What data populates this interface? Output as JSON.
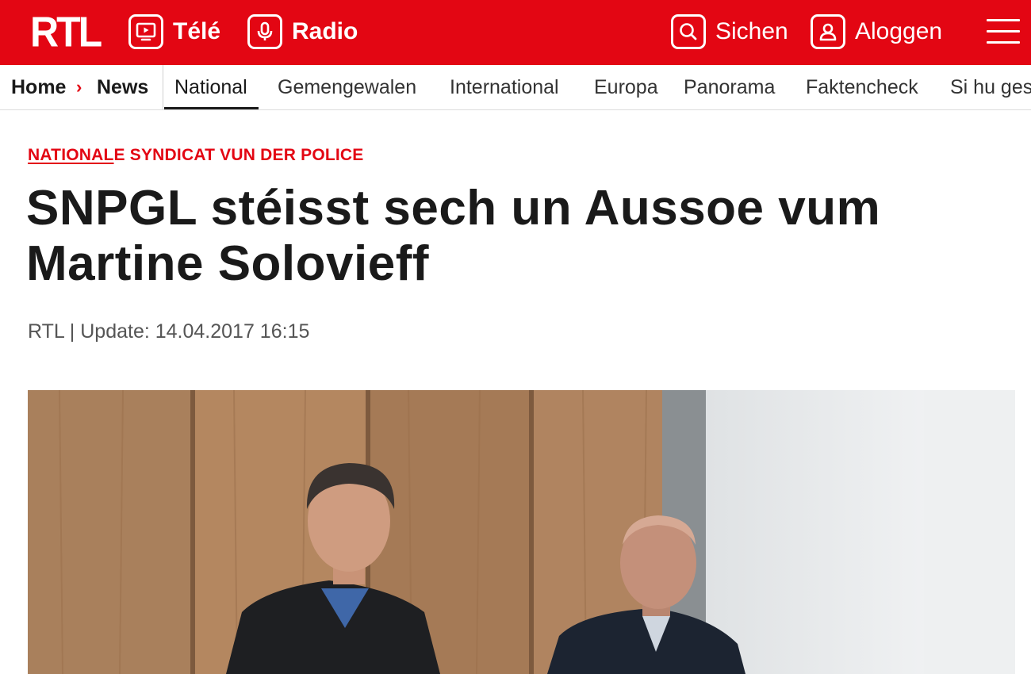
{
  "brand": {
    "logo": "RTL"
  },
  "topbar": {
    "tele_label": "Télé",
    "radio_label": "Radio",
    "search_label": "Sichen",
    "login_label": "Aloggen"
  },
  "breadcrumb": {
    "home": "Home",
    "separator": "›",
    "news": "News"
  },
  "subnav": {
    "items": [
      {
        "label": "National",
        "active": true
      },
      {
        "label": "Gemengewalen"
      },
      {
        "label": "International"
      },
      {
        "label": "Europa"
      },
      {
        "label": "Panorama"
      },
      {
        "label": "Faktencheck"
      },
      {
        "label": "Si hu gesot"
      }
    ]
  },
  "article": {
    "kicker_underlined": "NATIONAL",
    "kicker_rest": "E SYNDICAT VUN DER POLICE",
    "headline_line1": "SNPGL stéisst sech un Aussoe vum",
    "headline_line2": "Martine Solovieff",
    "meta": "RTL | Update: 14.04.2017 16:15"
  },
  "colors": {
    "brand_red": "#e30613",
    "text": "#1a1a1a"
  }
}
